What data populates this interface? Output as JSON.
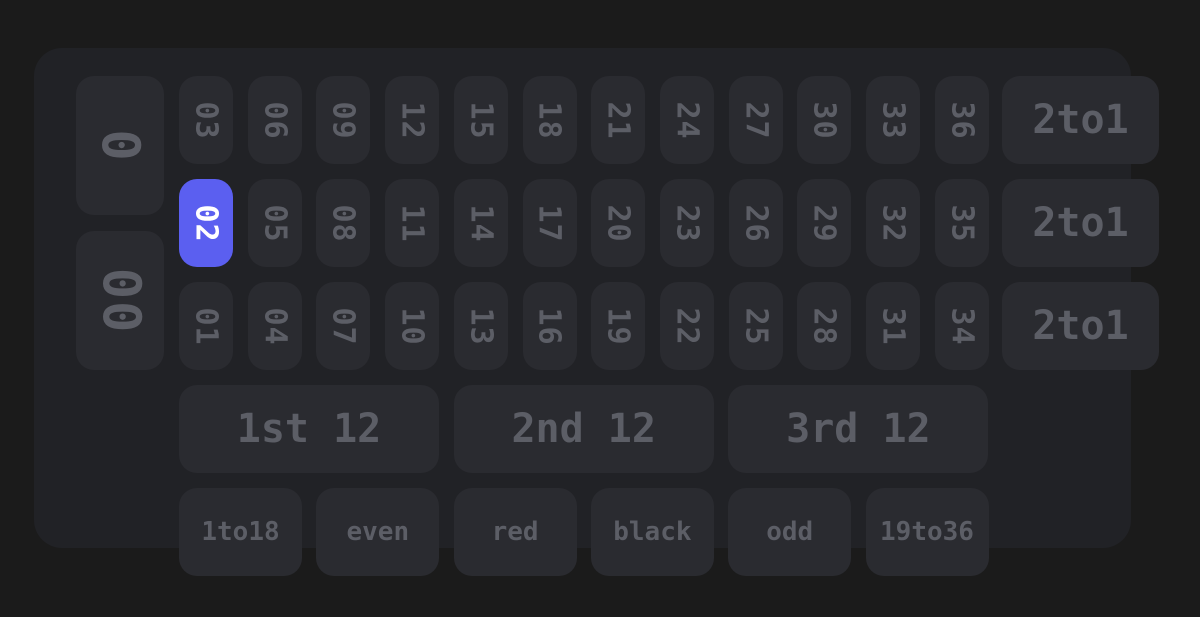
{
  "zeros": [
    "0",
    "00"
  ],
  "rows": [
    [
      "03",
      "06",
      "09",
      "12",
      "15",
      "18",
      "21",
      "24",
      "27",
      "30",
      "33",
      "36"
    ],
    [
      "02",
      "05",
      "08",
      "11",
      "14",
      "17",
      "20",
      "23",
      "26",
      "29",
      "32",
      "35"
    ],
    [
      "01",
      "04",
      "07",
      "10",
      "13",
      "16",
      "19",
      "22",
      "25",
      "28",
      "31",
      "34"
    ]
  ],
  "selected": "02",
  "columns": [
    "2to1",
    "2to1",
    "2to1"
  ],
  "dozens": [
    "1st 12",
    "2nd 12",
    "3rd 12"
  ],
  "outside": [
    "1to18",
    "even",
    "red",
    "black",
    "odd",
    "19to36"
  ],
  "colors": {
    "background": "#1b1b1b",
    "board": "#212226",
    "cell": "#2a2b30",
    "text": "#5c5e66",
    "accent": "#5b5ff0"
  }
}
